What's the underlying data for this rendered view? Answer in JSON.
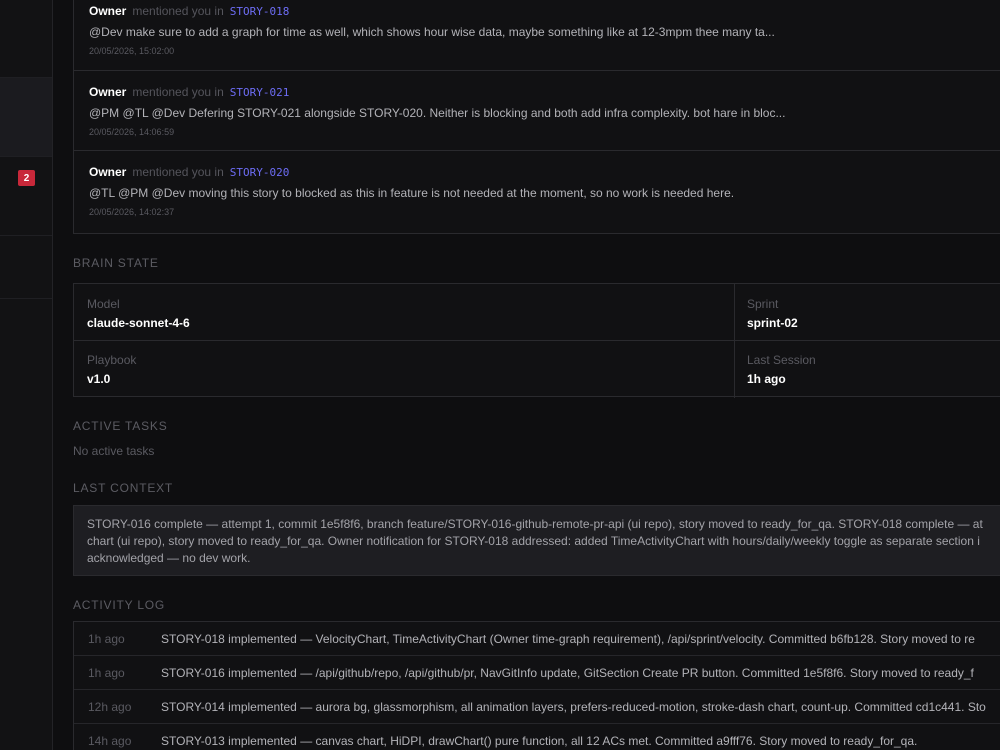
{
  "sidebar": {
    "badge_count": "2"
  },
  "mentions": [
    {
      "author": "Owner",
      "verb": "mentioned you in",
      "story": "STORY-018",
      "body": "@Dev make sure to add a graph for time as well, which shows hour wise data, maybe something like at 12-3mpm thee many ta...",
      "timestamp": "20/05/2026, 15:02:00"
    },
    {
      "author": "Owner",
      "verb": "mentioned you in",
      "story": "STORY-021",
      "body": "@PM @TL @Dev Defering STORY-021 alongside STORY-020. Neither is blocking and both add infra complexity. bot hare in bloc...",
      "timestamp": "20/05/2026, 14:06:59"
    },
    {
      "author": "Owner",
      "verb": "mentioned you in",
      "story": "STORY-020",
      "body": "@TL @PM @Dev moving this story to blocked as this in feature is not needed at the moment, so no work is needed here.",
      "timestamp": "20/05/2026, 14:02:37"
    }
  ],
  "brain_state": {
    "title": "BRAIN STATE",
    "model_label": "Model",
    "model_value": "claude-sonnet-4-6",
    "sprint_label": "Sprint",
    "sprint_value": "sprint-02",
    "playbook_label": "Playbook",
    "playbook_value": "v1.0",
    "session_label": "Last Session",
    "session_value": "1h ago"
  },
  "active_tasks": {
    "title": "ACTIVE TASKS",
    "empty_text": "No active tasks"
  },
  "last_context": {
    "title": "LAST CONTEXT",
    "lines": [
      "STORY-016 complete — attempt 1, commit 1e5f8f6, branch feature/STORY-016-github-remote-pr-api (ui repo), story moved to ready_for_qa. STORY-018 complete — at",
      "chart (ui repo), story moved to ready_for_qa. Owner notification for STORY-018 addressed: added TimeActivityChart with hours/daily/weekly toggle as separate section i",
      "acknowledged — no dev work."
    ]
  },
  "activity_log": {
    "title": "ACTIVITY LOG",
    "rows": [
      {
        "time": "1h ago",
        "msg": "STORY-018 implemented — VelocityChart, TimeActivityChart (Owner time-graph requirement), /api/sprint/velocity. Committed b6fb128. Story moved to re"
      },
      {
        "time": "1h ago",
        "msg": "STORY-016 implemented — /api/github/repo, /api/github/pr, NavGitInfo update, GitSection Create PR button. Committed 1e5f8f6. Story moved to ready_f"
      },
      {
        "time": "12h ago",
        "msg": "STORY-014 implemented — aurora bg, glassmorphism, all animation layers, prefers-reduced-motion, stroke-dash chart, count-up. Committed cd1c441. Sto"
      },
      {
        "time": "14h ago",
        "msg": "STORY-013 implemented — canvas chart, HiDPI, drawChart() pure function, all 12 ACs met. Committed a9fff76. Story moved to ready_for_qa."
      }
    ]
  }
}
